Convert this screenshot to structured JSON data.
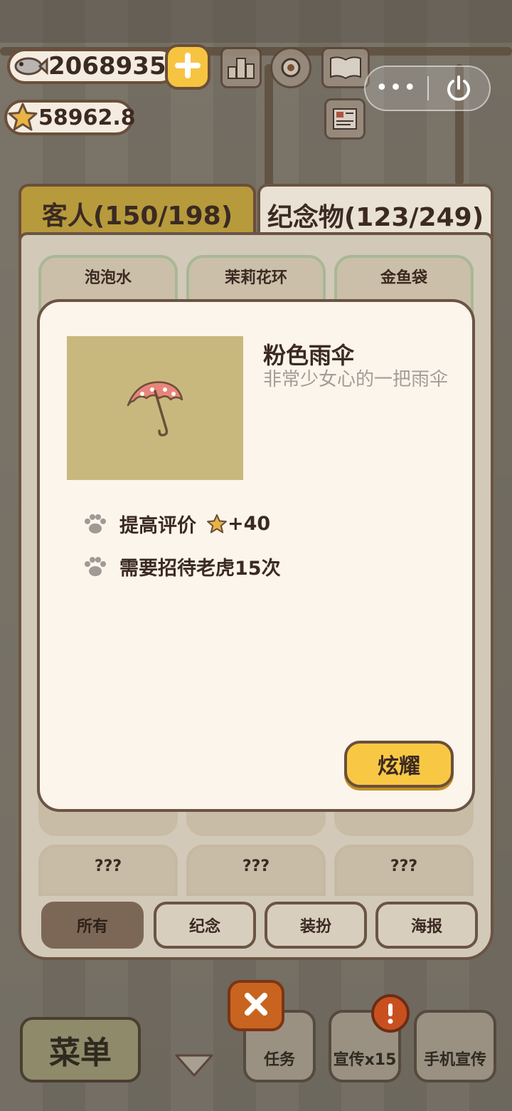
{
  "currency": {
    "fish_amount": "2068935",
    "star_amount": "58962.8"
  },
  "tabs": [
    {
      "label": "客人(150/198)"
    },
    {
      "label": "纪念物(123/249)"
    }
  ],
  "grid_top": [
    "泡泡水",
    "茉莉花环",
    "金鱼袋"
  ],
  "grid_locked": [
    "???",
    "???",
    "???"
  ],
  "item": {
    "name": "粉色雨伞",
    "description": "非常少女心的一把雨伞",
    "stats": [
      {
        "label": "提高评价",
        "value": "+40"
      },
      {
        "label": "需要招待老虎15次"
      }
    ],
    "show_button": "炫耀"
  },
  "filters": [
    {
      "label": "所有",
      "active": true
    },
    {
      "label": "纪念",
      "active": false
    },
    {
      "label": "装扮",
      "active": false
    },
    {
      "label": "海报",
      "active": false
    }
  ],
  "bottom": {
    "menu": "菜单",
    "tasks": "任务",
    "promo": "宣传x15",
    "phone_promo": "手机宣传"
  },
  "icons": {
    "fish": "fish-icon",
    "star": "star-icon",
    "plus": "plus-icon",
    "paw": "paw-icon",
    "close": "close-icon",
    "power": "power-icon",
    "more": "more-icon"
  },
  "colors": {
    "accent_yellow": "#f8c845",
    "active_tab": "#b79a3c",
    "panel_bg": "#d2c9b9",
    "modal_bg": "#fcf5ec",
    "text_dark": "#3b2a22",
    "text_muted": "#a39d96",
    "close_orange": "#c8641f"
  }
}
